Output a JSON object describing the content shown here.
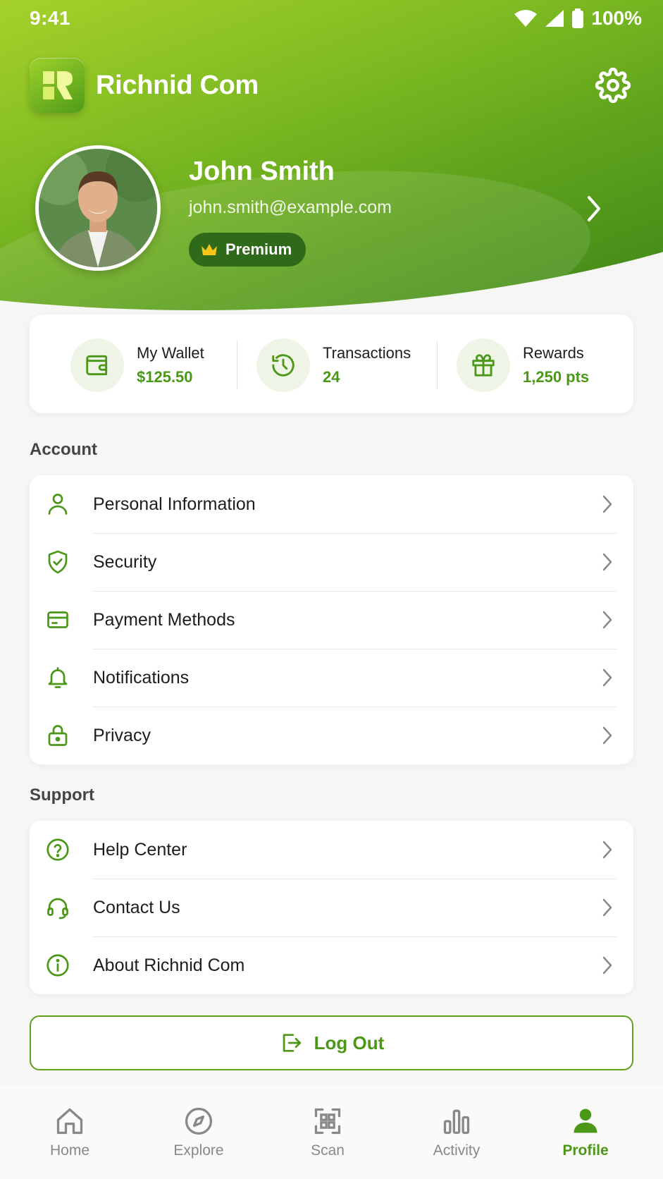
{
  "status_bar": {
    "time": "9:41",
    "battery": "100%"
  },
  "brand": {
    "name": "Richnid Com"
  },
  "profile": {
    "name": "John Smith",
    "email": "john.smith@example.com",
    "badge": "Premium"
  },
  "stats": [
    {
      "label": "My Wallet",
      "value": "$125.50",
      "icon": "wallet-icon"
    },
    {
      "label": "Transactions",
      "value": "24",
      "icon": "history-icon"
    },
    {
      "label": "Rewards",
      "value": "1,250 pts",
      "icon": "gift-icon"
    }
  ],
  "account": {
    "title": "Account",
    "items": [
      {
        "label": "Personal Information",
        "icon": "user-icon"
      },
      {
        "label": "Security",
        "icon": "shield-icon"
      },
      {
        "label": "Payment Methods",
        "icon": "credit-card-icon"
      },
      {
        "label": "Notifications",
        "icon": "bell-icon"
      },
      {
        "label": "Privacy",
        "icon": "lock-icon"
      }
    ]
  },
  "support": {
    "title": "Support",
    "items": [
      {
        "label": "Help Center",
        "icon": "help-circle-icon"
      },
      {
        "label": "Contact Us",
        "icon": "headset-icon"
      },
      {
        "label": "About Richnid Com",
        "icon": "info-icon"
      }
    ]
  },
  "logout": {
    "label": "Log Out"
  },
  "nav": [
    {
      "label": "Home",
      "icon": "home-icon"
    },
    {
      "label": "Explore",
      "icon": "compass-icon"
    },
    {
      "label": "Scan",
      "icon": "scan-icon"
    },
    {
      "label": "Activity",
      "icon": "bar-chart-icon"
    },
    {
      "label": "Profile",
      "icon": "person-icon",
      "active": true
    }
  ],
  "colors": {
    "accent": "#4b9718",
    "header_start": "#a6d12a",
    "header_end": "#3e8618",
    "badge_bg": "#2f6a1a"
  }
}
